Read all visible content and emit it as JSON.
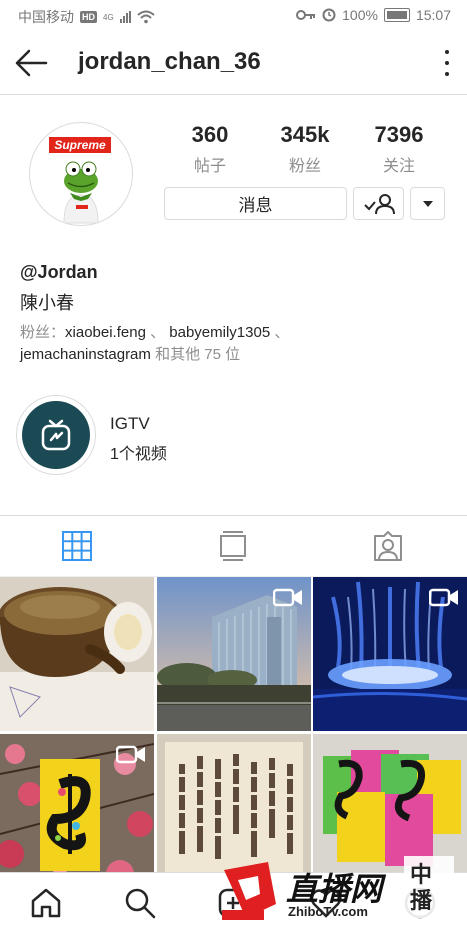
{
  "status_bar": {
    "carrier": "中国移动",
    "hd": "HD",
    "net": "4G",
    "battery": "100%",
    "time": "15:07"
  },
  "header": {
    "username": "jordan_chan_36"
  },
  "avatar": {
    "logo_text": "Supreme"
  },
  "stats": [
    {
      "value": "360",
      "label": "帖子"
    },
    {
      "value": "345k",
      "label": "粉丝"
    },
    {
      "value": "7396",
      "label": "关注"
    }
  ],
  "actions": {
    "message_label": "消息"
  },
  "profile": {
    "name": "@Jordan",
    "bio": "陳小春",
    "followers_prefix": "粉丝：",
    "follower_1": "xiaobei.feng",
    "sep": "、",
    "follower_2": "babyemily1305",
    "follower_3": "jemachaninstagram",
    "followers_suffix": "和其他 75 位"
  },
  "igtv": {
    "title": "IGTV",
    "subtitle": "1个视频"
  },
  "watermark": {
    "brand": "直播网",
    "url": "ZhiboTv.com"
  }
}
